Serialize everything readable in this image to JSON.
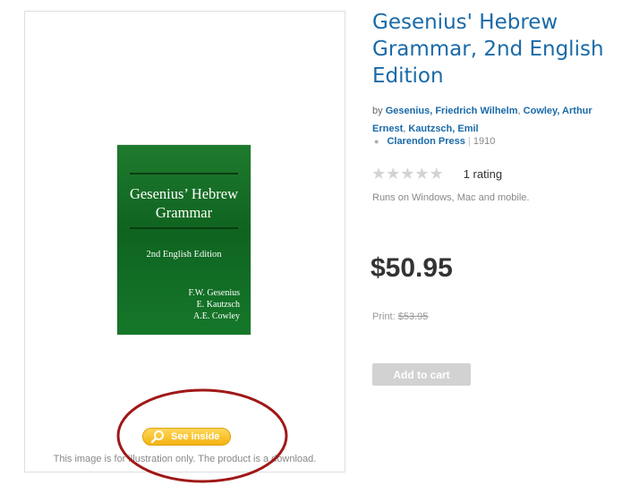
{
  "product": {
    "title": "Gesenius' Hebrew Grammar, 2nd English Edition",
    "by_prefix": "by",
    "authors": [
      "Gesenius, Friedrich Wilhelm",
      "Cowley, Arthur Ernest",
      "Kautzsch, Emil"
    ],
    "publisher": "Clarendon Press",
    "year": "1910",
    "rating": {
      "stars_filled": 0,
      "stars_total": 5,
      "count_text": "1 rating"
    },
    "platform_note": "Runs on Windows, Mac and mobile.",
    "price": "$50.95",
    "print_label": "Print:",
    "print_price": "$53.95",
    "add_to_cart_label": "Add to cart"
  },
  "cover": {
    "title_line1": "Gesenius’ Hebrew",
    "title_line2": "Grammar",
    "edition": "2nd English Edition",
    "author1": "F.W. Gesenius",
    "author2": "E. Kautzsch",
    "author3": "A.E. Cowley"
  },
  "image_panel": {
    "see_inside_label": "See inside",
    "disclaimer": "This image is for illustration only. The product is a download."
  },
  "colors": {
    "link": "#1a6aa8",
    "cover_green": "#0f6420",
    "see_inside": "#f3b312",
    "highlight_ring": "#a01818",
    "disabled_button": "#d2d2d2"
  },
  "icons": {
    "search": "magnifier-icon",
    "star": "star-icon"
  }
}
